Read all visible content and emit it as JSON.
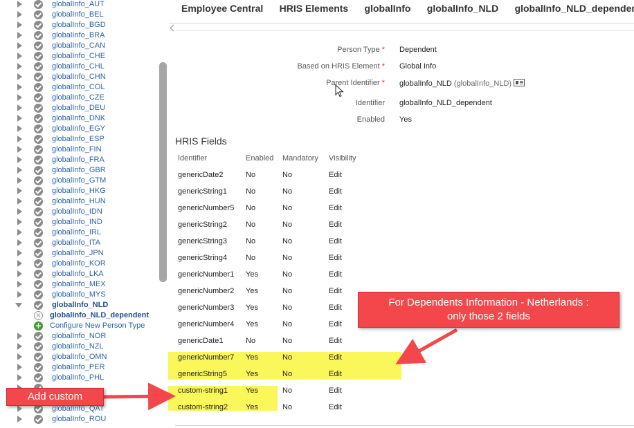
{
  "breadcrumbs": [
    "Employee Central",
    "HRIS Elements",
    "globalInfo",
    "globalInfo_NLD",
    "globalInfo_NLD_dependent"
  ],
  "tree": {
    "items": [
      {
        "label": "globalInfo_AUT",
        "icon": "check-circle-icon",
        "toggle": "collapsed"
      },
      {
        "label": "globalInfo_BEL",
        "icon": "check-circle-icon",
        "toggle": "collapsed"
      },
      {
        "label": "globalInfo_BGD",
        "icon": "check-circle-icon",
        "toggle": "collapsed"
      },
      {
        "label": "globalInfo_BRA",
        "icon": "check-circle-icon",
        "toggle": "collapsed"
      },
      {
        "label": "globalInfo_CAN",
        "icon": "check-circle-icon",
        "toggle": "collapsed"
      },
      {
        "label": "globalInfo_CHE",
        "icon": "check-circle-icon",
        "toggle": "collapsed"
      },
      {
        "label": "globalInfo_CHL",
        "icon": "check-circle-icon",
        "toggle": "collapsed"
      },
      {
        "label": "globalInfo_CHN",
        "icon": "check-circle-icon",
        "toggle": "collapsed"
      },
      {
        "label": "globalInfo_COL",
        "icon": "check-circle-icon",
        "toggle": "collapsed"
      },
      {
        "label": "globalInfo_CZE",
        "icon": "check-circle-icon",
        "toggle": "collapsed"
      },
      {
        "label": "globalInfo_DEU",
        "icon": "check-circle-icon",
        "toggle": "collapsed"
      },
      {
        "label": "globalInfo_DNK",
        "icon": "check-circle-icon",
        "toggle": "collapsed"
      },
      {
        "label": "globalInfo_EGY",
        "icon": "check-circle-icon",
        "toggle": "collapsed"
      },
      {
        "label": "globalInfo_ESP",
        "icon": "check-circle-icon",
        "toggle": "collapsed"
      },
      {
        "label": "globalInfo_FIN",
        "icon": "check-circle-icon",
        "toggle": "collapsed"
      },
      {
        "label": "globalInfo_FRA",
        "icon": "check-circle-icon",
        "toggle": "collapsed"
      },
      {
        "label": "globalInfo_GBR",
        "icon": "check-circle-icon",
        "toggle": "collapsed"
      },
      {
        "label": "globalInfo_GTM",
        "icon": "check-circle-icon",
        "toggle": "collapsed"
      },
      {
        "label": "globalInfo_HKG",
        "icon": "check-circle-icon",
        "toggle": "collapsed"
      },
      {
        "label": "globalInfo_HUN",
        "icon": "check-circle-icon",
        "toggle": "collapsed"
      },
      {
        "label": "globalInfo_IDN",
        "icon": "check-circle-icon",
        "toggle": "collapsed"
      },
      {
        "label": "globalInfo_IND",
        "icon": "check-circle-icon",
        "toggle": "collapsed"
      },
      {
        "label": "globalInfo_IRL",
        "icon": "check-circle-icon",
        "toggle": "collapsed"
      },
      {
        "label": "globalInfo_ITA",
        "icon": "check-circle-icon",
        "toggle": "collapsed"
      },
      {
        "label": "globalInfo_JPN",
        "icon": "check-circle-icon",
        "toggle": "collapsed"
      },
      {
        "label": "globalInfo_KOR",
        "icon": "check-circle-icon",
        "toggle": "collapsed"
      },
      {
        "label": "globalInfo_LKA",
        "icon": "check-circle-icon",
        "toggle": "collapsed"
      },
      {
        "label": "globalInfo_MEX",
        "icon": "check-circle-icon",
        "toggle": "collapsed"
      },
      {
        "label": "globalInfo_MYS",
        "icon": "check-circle-icon",
        "toggle": "collapsed"
      },
      {
        "label": "globalInfo_NLD",
        "icon": "check-circle-icon",
        "toggle": "expanded",
        "bold": true
      },
      {
        "label": "globalInfo_NLD_dependent",
        "icon": "remove-circle-icon",
        "toggle": "none",
        "child": true,
        "selected": true
      },
      {
        "label": "Configure New Person Type",
        "icon": "add-circle-icon",
        "toggle": "none",
        "child": true
      },
      {
        "label": "globalInfo_NOR",
        "icon": "check-circle-icon",
        "toggle": "collapsed"
      },
      {
        "label": "globalInfo_NZL",
        "icon": "check-circle-icon",
        "toggle": "collapsed"
      },
      {
        "label": "globalInfo_OMN",
        "icon": "check-circle-icon",
        "toggle": "collapsed"
      },
      {
        "label": "globalInfo_PER",
        "icon": "check-circle-icon",
        "toggle": "collapsed"
      },
      {
        "label": "globalInfo_PHL",
        "icon": "check-circle-icon",
        "toggle": "collapsed"
      },
      {
        "label": "",
        "icon": "check-circle-icon",
        "toggle": "collapsed"
      },
      {
        "label": "",
        "icon": "check-circle-icon",
        "toggle": "collapsed"
      },
      {
        "label": "globalInfo_QAT",
        "icon": "check-circle-icon",
        "toggle": "collapsed"
      },
      {
        "label": "globalInfo_ROU",
        "icon": "check-circle-icon",
        "toggle": "collapsed"
      }
    ]
  },
  "form": {
    "person_type_label": "Person Type",
    "person_type_value": "Dependent",
    "based_on_label": "Based on HRIS Element",
    "based_on_value": "Global Info",
    "parent_id_label": "Parent Identifier",
    "parent_id_value": "globalInfo_NLD",
    "parent_id_sub": "(globalInfo_NLD)",
    "identifier_label": "Identifier",
    "identifier_value": "globalInfo_NLD_dependent",
    "enabled_label": "Enabled",
    "enabled_value": "Yes",
    "required_mark": "*"
  },
  "hris": {
    "title": "HRIS Fields",
    "headers": [
      "Identifier",
      "Enabled",
      "Mandatory",
      "Visibility"
    ],
    "rows": [
      [
        "genericDate2",
        "No",
        "No",
        "Edit"
      ],
      [
        "genericString1",
        "No",
        "No",
        "Edit"
      ],
      [
        "genericNumber5",
        "No",
        "No",
        "Edit"
      ],
      [
        "genericString2",
        "No",
        "No",
        "Edit"
      ],
      [
        "genericString3",
        "No",
        "No",
        "Edit"
      ],
      [
        "genericString4",
        "No",
        "No",
        "Edit"
      ],
      [
        "genericNumber1",
        "Yes",
        "No",
        "Edit"
      ],
      [
        "genericNumber2",
        "Yes",
        "No",
        "Edit"
      ],
      [
        "genericNumber3",
        "Yes",
        "No",
        "Edit"
      ],
      [
        "genericNumber4",
        "Yes",
        "No",
        "Edit"
      ],
      [
        "genericDate1",
        "No",
        "No",
        "Edit"
      ],
      [
        "genericNumber7",
        "Yes",
        "No",
        "Edit"
      ],
      [
        "genericString5",
        "Yes",
        "No",
        "Edit"
      ],
      [
        "custom-string1",
        "Yes",
        "No",
        "Edit"
      ],
      [
        "custom-string2",
        "Yes",
        "No",
        "Edit"
      ]
    ]
  },
  "annotations": {
    "nl_callout_line1": "For Dependents Information - Netherlands :",
    "nl_callout_line2": "only those 2 fields",
    "custom_callout": "Add custom"
  },
  "colors": {
    "link": "#2d63a8",
    "highlight": "#faf75a",
    "callout": "#f4474b",
    "required": "#dd3322",
    "check_icon": "#8a8a8a",
    "add_icon": "#3c9a2e"
  }
}
